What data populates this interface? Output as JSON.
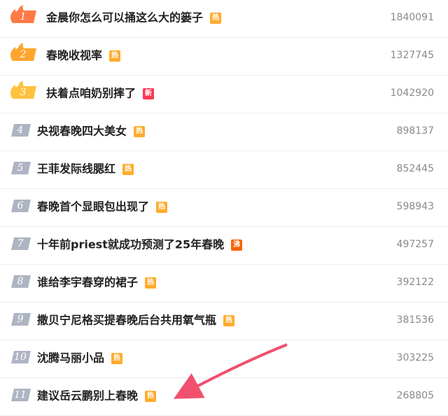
{
  "colors": {
    "hot_badge": "#ffab2d",
    "new_badge": "#ff3852",
    "boil_badge": "#f86400",
    "rank1": "#ff7a45",
    "rank2": "#ffa52e",
    "rank3": "#ffc23d",
    "rank_default": "#aeb4c2",
    "arrow": "#f0506e"
  },
  "trending": [
    {
      "rank": "1",
      "title": "金晨你怎么可以捅这么大的篓子",
      "badge": "热",
      "badge_type": "hot",
      "count": "1840091",
      "flame": true
    },
    {
      "rank": "2",
      "title": "春晚收视率",
      "badge": "热",
      "badge_type": "hot",
      "count": "1327745",
      "flame": true
    },
    {
      "rank": "3",
      "title": "扶着点咱奶别摔了",
      "badge": "新",
      "badge_type": "new",
      "count": "1042920",
      "flame": true
    },
    {
      "rank": "4",
      "title": "央视春晚四大美女",
      "badge": "热",
      "badge_type": "hot",
      "count": "898137",
      "flame": false
    },
    {
      "rank": "5",
      "title": "王菲发际线腮红",
      "badge": "热",
      "badge_type": "hot",
      "count": "852445",
      "flame": false
    },
    {
      "rank": "6",
      "title": "春晚首个显眼包出现了",
      "badge": "热",
      "badge_type": "hot",
      "count": "598943",
      "flame": false
    },
    {
      "rank": "7",
      "title": "十年前priest就成功预测了25年春晚",
      "badge": "沸",
      "badge_type": "boil",
      "count": "497257",
      "flame": false
    },
    {
      "rank": "8",
      "title": "谁给李宇春穿的裙子",
      "badge": "热",
      "badge_type": "hot",
      "count": "392122",
      "flame": false
    },
    {
      "rank": "9",
      "title": "撒贝宁尼格买提春晚后台共用氧气瓶",
      "badge": "热",
      "badge_type": "hot",
      "count": "381536",
      "flame": false
    },
    {
      "rank": "10",
      "title": "沈腾马丽小品",
      "badge": "热",
      "badge_type": "hot",
      "count": "303225",
      "flame": false
    },
    {
      "rank": "11",
      "title": "建议岳云鹏别上春晚",
      "badge": "热",
      "badge_type": "hot",
      "count": "268805",
      "flame": false
    }
  ]
}
